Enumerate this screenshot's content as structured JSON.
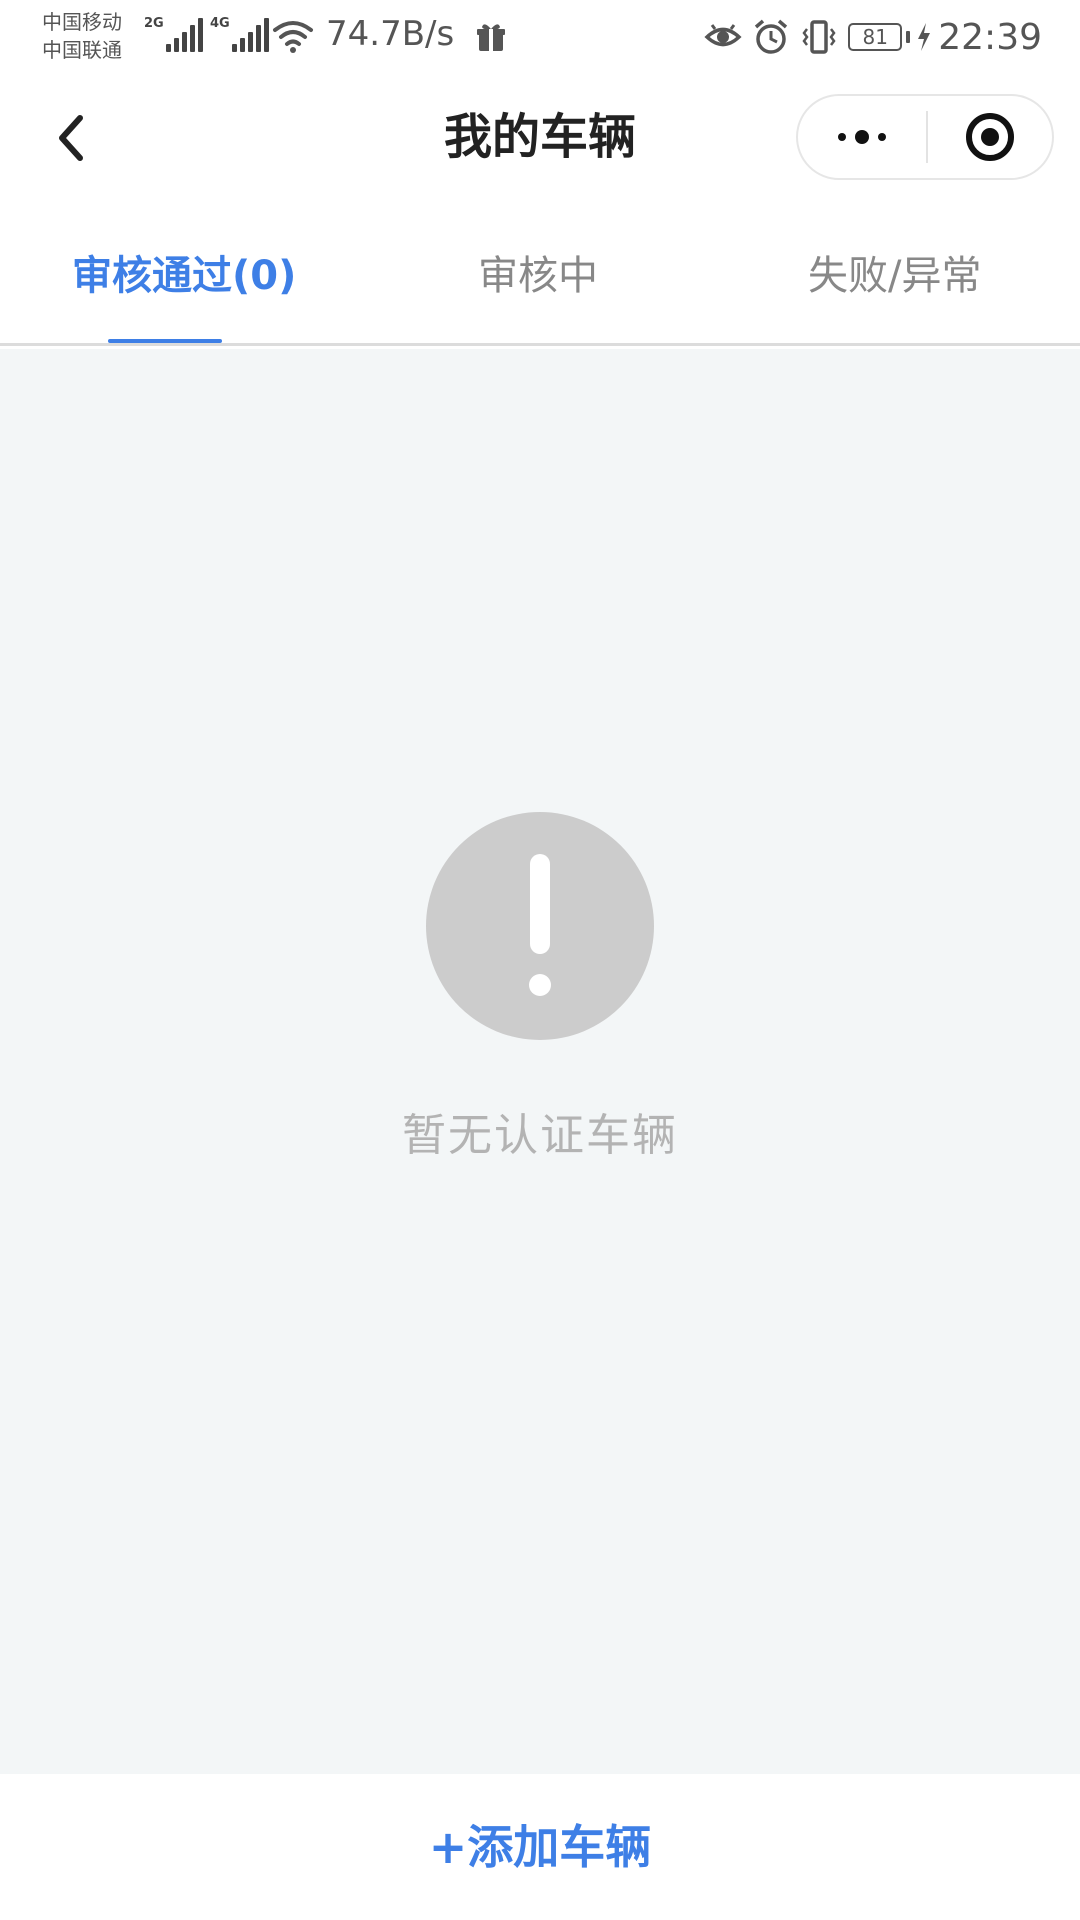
{
  "status_bar": {
    "carrier_1": "中国移动",
    "carrier_2": "中国联通",
    "network_1": "2G",
    "network_2": "4G",
    "net_speed": "74.7B/s",
    "battery": "81",
    "time": "22:39",
    "icons": [
      "signal-icon",
      "wifi-icon",
      "gift-icon",
      "eye-icon",
      "alarm-icon",
      "vibrate-icon",
      "battery-icon",
      "charging-icon"
    ]
  },
  "nav": {
    "title": "我的车辆",
    "back_icon": "chevron-left-icon",
    "more_icon": "more-dots-icon",
    "close_icon": "target-close-icon"
  },
  "tabs": [
    {
      "label": "审核通过(0)",
      "active": true
    },
    {
      "label": "审核中",
      "active": false
    },
    {
      "label": "失败/异常",
      "active": false
    }
  ],
  "empty_state": {
    "icon": "exclamation-circle-icon",
    "message": "暂无认证车辆"
  },
  "footer": {
    "add_label": "+添加车辆"
  },
  "colors": {
    "accent": "#3e7fe6",
    "content_bg": "#f3f6f7",
    "empty_icon": "#cccccc",
    "muted_text": "#b3b3b3"
  }
}
